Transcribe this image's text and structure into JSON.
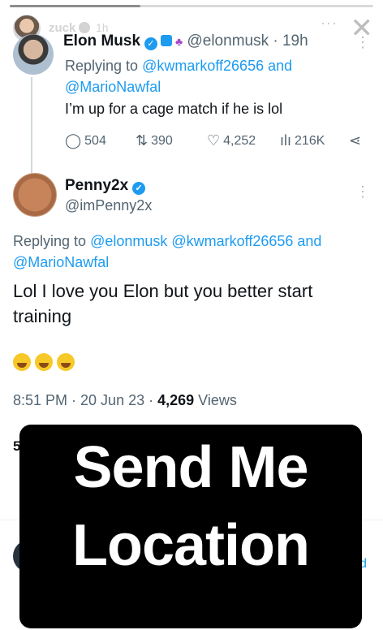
{
  "story": {
    "username": "zuck",
    "time": "1h",
    "close_glyph": "✕",
    "more_glyph": "···",
    "progress": 0.36
  },
  "tweet_parent": {
    "name": "Elon Musk",
    "handle": "@elonmusk",
    "time": "· 19h",
    "replying_prefix": "Replying to",
    "replying_to": "@kwmarkoff26656 and @MarioNawfal",
    "text": "I’m up for a cage match if he is lol",
    "actions": {
      "replies": "504",
      "retweets": "390",
      "likes": "4,252",
      "views": "216K"
    }
  },
  "tweet_reply": {
    "name": "Penny2x",
    "handle": "@imPenny2x",
    "replying_prefix": "Replying to",
    "replying_to": "@elonmusk @kwmarkoff26656 and @MarioNawfal",
    "text": "Lol I love you Elon but you better start training",
    "timestamp": "8:51 PM · 20 Jun 23 · ",
    "views_count": "4,269",
    "views_label": " Views",
    "partial_stat": "5"
  },
  "overlay": {
    "line1": "Send Me",
    "line2": "Location"
  },
  "colors": {
    "link": "#1d9bf0",
    "muted": "#536471",
    "overlay_bg": "#000000"
  }
}
